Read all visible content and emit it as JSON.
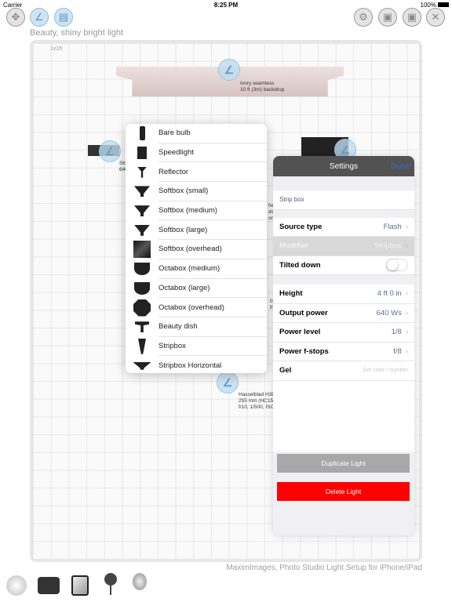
{
  "status_bar": {
    "carrier": "Carrier",
    "time": "8:25 PM",
    "battery": "100%"
  },
  "toolbar": {
    "left": [
      "move-icon",
      "light-icon",
      "preview-icon"
    ],
    "right": [
      "gear-icon",
      "save-icon",
      "save-as-icon",
      "close-icon"
    ]
  },
  "scene": {
    "title": "Beauty, shiny bright light",
    "grid_label": "1x1ft",
    "backdrop_label_1": "Ivory seamless",
    "backdrop_label_2": "10 ft (3m) backdrop",
    "left_light_label_1": "Stri",
    "left_light_label_2": "640",
    "mid_frag_1": "he",
    "mid_frag_2": "ds",
    "mid_frag_3": "or (",
    "mid_frag_4": "0\"",
    "mid_frag_5": "f/8",
    "camera_label_1": "Hasselblad H3D",
    "camera_label_2": "255 mm (HC15",
    "camera_label_3": "f/10, 1/500, ISC"
  },
  "modifier_menu": {
    "items": [
      {
        "label": "Bare bulb",
        "icon": "bare-bulb"
      },
      {
        "label": "Speedlight",
        "icon": "speedlight"
      },
      {
        "label": "Reflector",
        "icon": "reflector"
      },
      {
        "label": "Softbox (small)",
        "icon": "softbox"
      },
      {
        "label": "Softbox (medium)",
        "icon": "softbox"
      },
      {
        "label": "Softbox (large)",
        "icon": "softbox"
      },
      {
        "label": "Softbox (overhead)",
        "icon": "softbox-overhead"
      },
      {
        "label": "Octabox (medium)",
        "icon": "octabox"
      },
      {
        "label": "Octabox (large)",
        "icon": "octabox"
      },
      {
        "label": "Octabox (overhead)",
        "icon": "octabox-overhead"
      },
      {
        "label": "Beauty dish",
        "icon": "beauty-dish"
      },
      {
        "label": "Stripbox",
        "icon": "stripbox"
      },
      {
        "label": "Stripbox Horizontal",
        "icon": "stripbox-horizontal"
      }
    ]
  },
  "settings": {
    "title": "Settings",
    "done": "Done",
    "name": "Strip box",
    "source_type": {
      "label": "Source type",
      "value": "Flash"
    },
    "modifier": {
      "label": "Modifier",
      "value": "Stripbox"
    },
    "tilted_down": {
      "label": "Tilted down",
      "on": false
    },
    "height": {
      "label": "Height",
      "value": "4 ft 0 in"
    },
    "output_power": {
      "label": "Output power",
      "value": "640 Ws"
    },
    "power_level": {
      "label": "Power level",
      "value": "1/8"
    },
    "power_fstops": {
      "label": "Power f-stops",
      "value": "f/8"
    },
    "gel": {
      "label": "Gel",
      "placeholder": "Gel color / number"
    },
    "duplicate": "Duplicate Light",
    "delete": "Delete Light",
    "colors": {
      "duplicate": "#a8a8a8",
      "delete": "#ff0000",
      "done": "#2f6fd6"
    }
  },
  "footer": "MaximImages, Photo Studio Light Setup for iPhone/iPad",
  "bottom_bar": [
    "backdrop-icon",
    "camera-icon",
    "reflector-panel-icon",
    "light-stand-icon",
    "model-head-icon"
  ]
}
